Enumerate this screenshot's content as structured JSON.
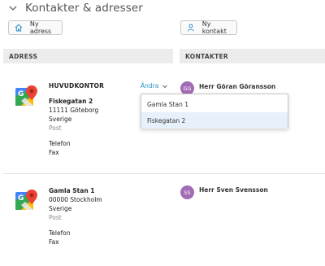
{
  "header": {
    "title": "Kontakter & adresser",
    "collapse_icon": "chevron-down-icon"
  },
  "toolbar": {
    "new_address_label": "Ny adress",
    "new_address_icon": "home-icon",
    "new_contact_label": "Ny kontakt",
    "new_contact_icon": "person-icon"
  },
  "columns": {
    "address": "ADRESS",
    "contacts": "KONTAKTER"
  },
  "addresses": [
    {
      "name": "HUVUDKONTOR",
      "street": "Fiskegatan 2",
      "postal": "11111 Göteborg",
      "country": "Sverige",
      "type": "Post",
      "phone_label": "Telefon",
      "fax_label": "Fax",
      "change_label": "Ändra"
    },
    {
      "street": "Gamla Stan 1",
      "postal": "00000 Stockholm",
      "country": "Sverige",
      "type": "Post",
      "phone_label": "Telefon",
      "fax_label": "Fax"
    }
  ],
  "contacts": [
    {
      "initials": "GG",
      "name": "Herr Göran Göransson"
    },
    {
      "initials": "SS",
      "name": "Herr Sven Svensson"
    }
  ],
  "dropdown": {
    "options": [
      "Gamla Stan 1",
      "Fiskegatan 2"
    ],
    "selected": "Fiskegatan 2"
  },
  "colors": {
    "accent_link": "#2a8fc7",
    "avatar": "#a26bb5",
    "selected_option": "#e6f1fb"
  }
}
